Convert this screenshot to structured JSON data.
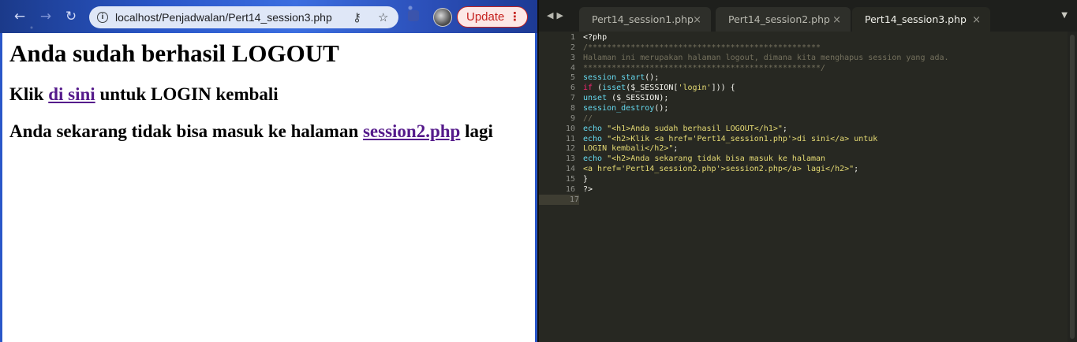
{
  "browser": {
    "url": "localhost/Penjadwalan/Pert14_session3.php",
    "update_label": "Update",
    "page": {
      "h1": "Anda sudah berhasil LOGOUT",
      "line1_prefix": "Klik ",
      "line1_link": "di sini",
      "line1_suffix": " untuk LOGIN kembali",
      "line2_prefix": "Anda sekarang tidak bisa masuk ke halaman ",
      "line2_link": "session2.php",
      "line2_suffix": " lagi"
    }
  },
  "editor": {
    "tabs": [
      {
        "label": "Pert14_session1.php",
        "active": false
      },
      {
        "label": "Pert14_session2.php",
        "active": false
      },
      {
        "label": "Pert14_session3.php",
        "active": true
      }
    ],
    "close_glyph": "×",
    "current_line": 17,
    "lines": [
      {
        "n": 1,
        "tokens": [
          {
            "t": "<?php",
            "c": "plain"
          }
        ]
      },
      {
        "n": 2,
        "tokens": [
          {
            "t": "/*************************************************",
            "c": "comment"
          }
        ]
      },
      {
        "n": 3,
        "tokens": [
          {
            "t": "Halaman ini merupakan halaman logout, dimana kita menghapus session yang ada.",
            "c": "comment"
          }
        ]
      },
      {
        "n": 4,
        "tokens": [
          {
            "t": "**************************************************/",
            "c": "comment"
          }
        ]
      },
      {
        "n": 5,
        "tokens": [
          {
            "t": "session_start",
            "c": "func"
          },
          {
            "t": "();",
            "c": "plain"
          }
        ]
      },
      {
        "n": 6,
        "tokens": [
          {
            "t": "if",
            "c": "kw"
          },
          {
            "t": " (",
            "c": "plain"
          },
          {
            "t": "isset",
            "c": "func"
          },
          {
            "t": "($_SESSION[",
            "c": "plain"
          },
          {
            "t": "'login'",
            "c": "str"
          },
          {
            "t": "])) {",
            "c": "plain"
          }
        ]
      },
      {
        "n": 7,
        "tokens": [
          {
            "t": "unset",
            "c": "func"
          },
          {
            "t": " ($_SESSION);",
            "c": "plain"
          }
        ]
      },
      {
        "n": 8,
        "tokens": [
          {
            "t": "session_destroy",
            "c": "func"
          },
          {
            "t": "();",
            "c": "plain"
          }
        ]
      },
      {
        "n": 9,
        "tokens": [
          {
            "t": "//",
            "c": "comment"
          }
        ]
      },
      {
        "n": 10,
        "tokens": [
          {
            "t": "echo",
            "c": "func"
          },
          {
            "t": " ",
            "c": "plain"
          },
          {
            "t": "\"<h1>Anda sudah berhasil LOGOUT</h1>\"",
            "c": "str"
          },
          {
            "t": ";",
            "c": "plain"
          }
        ]
      },
      {
        "n": 11,
        "tokens": [
          {
            "t": "echo",
            "c": "func"
          },
          {
            "t": " ",
            "c": "plain"
          },
          {
            "t": "\"<h2>Klik <a href='Pert14_session1.php'>di sini</a> untuk",
            "c": "str"
          }
        ]
      },
      {
        "n": 12,
        "tokens": [
          {
            "t": "LOGIN kembali</h2>\"",
            "c": "str"
          },
          {
            "t": ";",
            "c": "plain"
          }
        ]
      },
      {
        "n": 13,
        "tokens": [
          {
            "t": "echo",
            "c": "func"
          },
          {
            "t": " ",
            "c": "plain"
          },
          {
            "t": "\"<h2>Anda sekarang tidak bisa masuk ke halaman",
            "c": "str"
          }
        ]
      },
      {
        "n": 14,
        "tokens": [
          {
            "t": "<a href='Pert14_session2.php'>session2.php</a> lagi</h2>\"",
            "c": "str"
          },
          {
            "t": ";",
            "c": "plain"
          }
        ]
      },
      {
        "n": 15,
        "tokens": [
          {
            "t": "}",
            "c": "plain"
          }
        ]
      },
      {
        "n": 16,
        "tokens": [
          {
            "t": "?>",
            "c": "plain"
          }
        ]
      },
      {
        "n": 17,
        "tokens": []
      }
    ]
  },
  "colors": {
    "link": "#551a8b",
    "editor_bg": "#272822",
    "comment": "#75715e",
    "function": "#66d9ef",
    "keyword": "#f92672",
    "string": "#e6db74"
  }
}
